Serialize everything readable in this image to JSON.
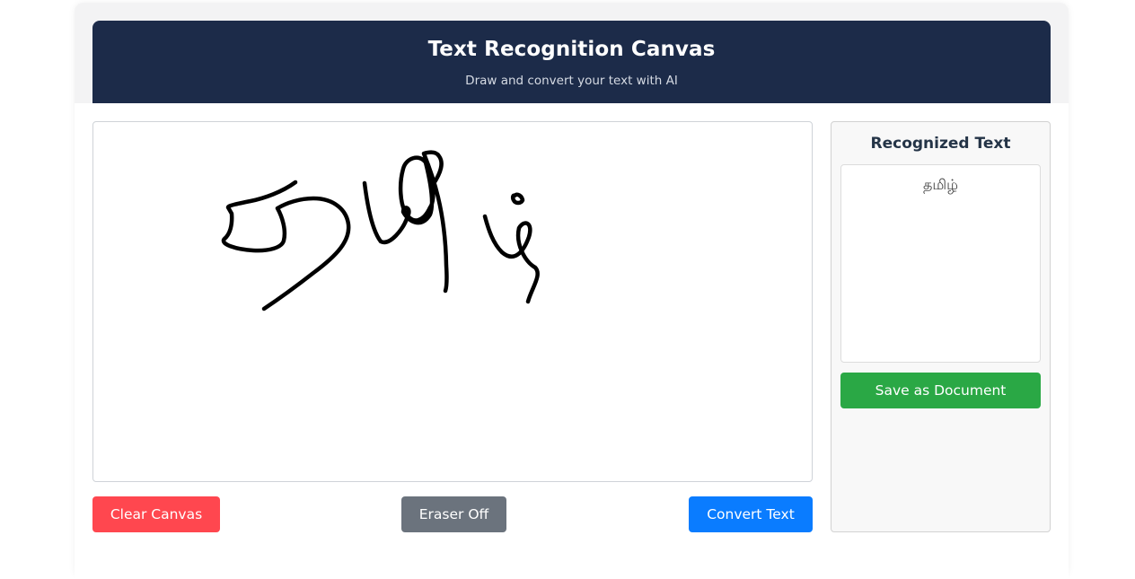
{
  "header": {
    "title": "Text Recognition Canvas",
    "subtitle": "Draw and convert your text with AI"
  },
  "canvas": {
    "stroke_color": "#000000",
    "background": "#ffffff"
  },
  "controls": {
    "clear_label": "Clear Canvas",
    "eraser_label": "Eraser Off",
    "convert_label": "Convert Text"
  },
  "sidebar": {
    "title": "Recognized Text",
    "recognized_text": "தமிழ்",
    "save_label": "Save as Document"
  },
  "colors": {
    "header_bg": "#1c2b49",
    "clear": "#ff474f",
    "eraser": "#6b737d",
    "convert": "#0a7cff",
    "save": "#2aa845"
  }
}
